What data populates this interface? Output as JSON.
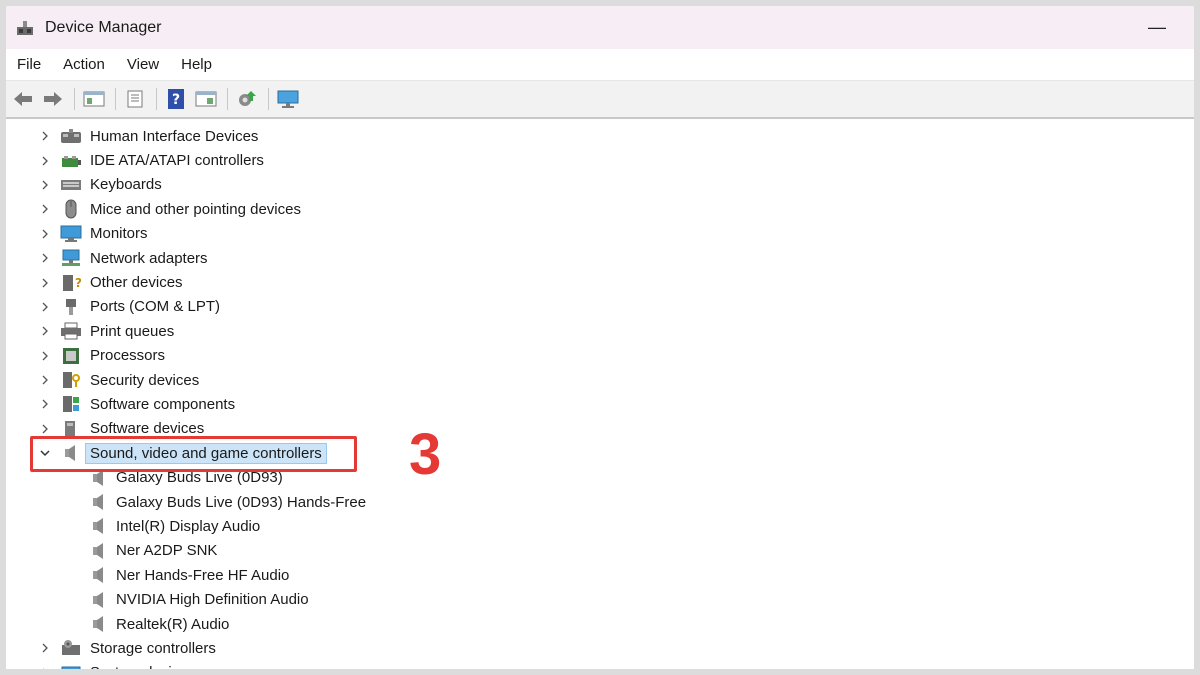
{
  "window": {
    "title": "Device Manager",
    "minimize_glyph": "—"
  },
  "menu": [
    "File",
    "Action",
    "View",
    "Help"
  ],
  "toolbar": [
    "back-icon",
    "forward-icon",
    "show-hide-tree-icon",
    "properties-icon",
    "help-icon",
    "console-view-icon",
    "update-driver-icon",
    "scan-hardware-icon"
  ],
  "tree": {
    "categories": [
      {
        "label": "Human Interface Devices",
        "icon": "hid-icon"
      },
      {
        "label": "IDE ATA/ATAPI controllers",
        "icon": "ide-controller-icon"
      },
      {
        "label": "Keyboards",
        "icon": "keyboard-icon"
      },
      {
        "label": "Mice and other pointing devices",
        "icon": "mouse-icon"
      },
      {
        "label": "Monitors",
        "icon": "monitor-icon"
      },
      {
        "label": "Network adapters",
        "icon": "network-adapter-icon"
      },
      {
        "label": "Other devices",
        "icon": "other-devices-icon"
      },
      {
        "label": "Ports (COM & LPT)",
        "icon": "port-icon"
      },
      {
        "label": "Print queues",
        "icon": "printer-icon"
      },
      {
        "label": "Processors",
        "icon": "processor-icon"
      },
      {
        "label": "Security devices",
        "icon": "security-device-icon"
      },
      {
        "label": "Software components",
        "icon": "software-component-icon"
      },
      {
        "label": "Software devices",
        "icon": "software-device-icon"
      }
    ],
    "expanded": {
      "label": "Sound, video and game controllers",
      "icon": "speaker-icon",
      "children": [
        "Galaxy Buds Live (0D93)",
        "Galaxy Buds Live (0D93) Hands-Free",
        "Intel(R) Display Audio",
        "Ner A2DP SNK",
        "Ner Hands-Free HF Audio",
        "NVIDIA High Definition Audio",
        "Realtek(R) Audio"
      ]
    },
    "after": [
      {
        "label": "Storage controllers",
        "icon": "storage-controller-icon"
      },
      {
        "label": "System devices",
        "icon": "system-devices-icon"
      }
    ]
  },
  "annotation": {
    "step": "3",
    "color": "#e53935"
  },
  "colors": {
    "selection_bg": "#cce4f7",
    "selection_border": "#99c9ef",
    "titlebar": "#f6eef4"
  }
}
